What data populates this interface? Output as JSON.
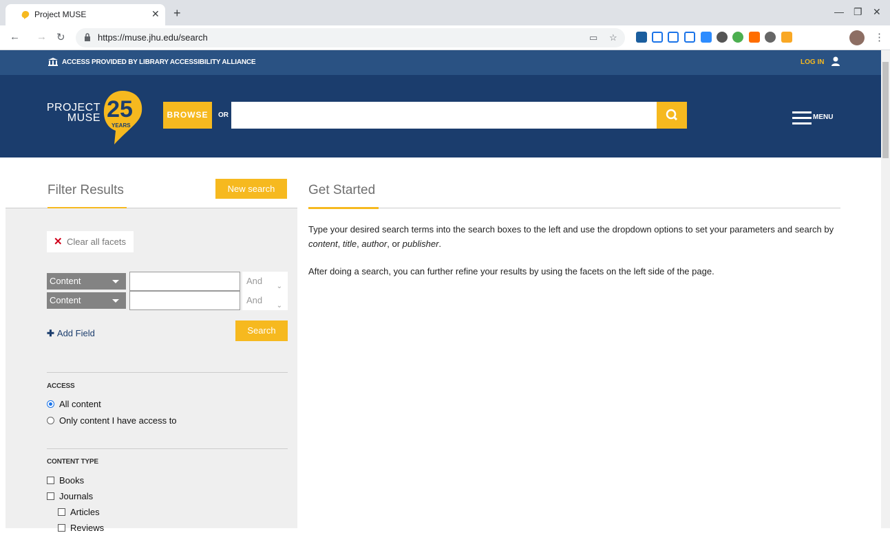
{
  "browser": {
    "tab_title": "Project MUSE",
    "url": "https://muse.jhu.edu/search"
  },
  "topbar": {
    "access_text": "ACCESS PROVIDED BY LIBRARY ACCESSIBILITY ALLIANCE",
    "login_label": "LOG IN"
  },
  "header": {
    "logo_line1": "PROJECT",
    "logo_line2": "MUSE",
    "logo_number": "25",
    "logo_years": "YEARS",
    "browse_label": "BROWSE",
    "or_label": "OR",
    "search_value": "",
    "menu_label": "MENU"
  },
  "filter": {
    "title": "Filter Results",
    "new_search_label": "New search",
    "clear_label": "Clear all facets",
    "rows": [
      {
        "field": "Content",
        "value": "",
        "op": "And"
      },
      {
        "field": "Content",
        "value": "",
        "op": "And"
      }
    ],
    "add_field_label": "Add Field",
    "search_label": "Search",
    "access": {
      "heading": "ACCESS",
      "options": [
        "All content",
        "Only content I have access to"
      ],
      "selected": "All content"
    },
    "content_type": {
      "heading": "CONTENT TYPE",
      "options": [
        "Books",
        "Journals",
        "Articles",
        "Reviews"
      ]
    }
  },
  "main": {
    "title": "Get Started",
    "p1_a": "Type your desired search terms into the search boxes to the left and use the dropdown options to set your parameters and search by ",
    "p1_content": "content",
    "p1_title": "title",
    "p1_author": "author",
    "p1_or": ", or ",
    "p1_publisher": "publisher",
    "p2": "After doing a search, you can further refine your results by using the facets on the left side of the page."
  },
  "colors": {
    "accent": "#f6b91f",
    "navy": "#1b3d6d",
    "access_bar": "#2a5283"
  }
}
